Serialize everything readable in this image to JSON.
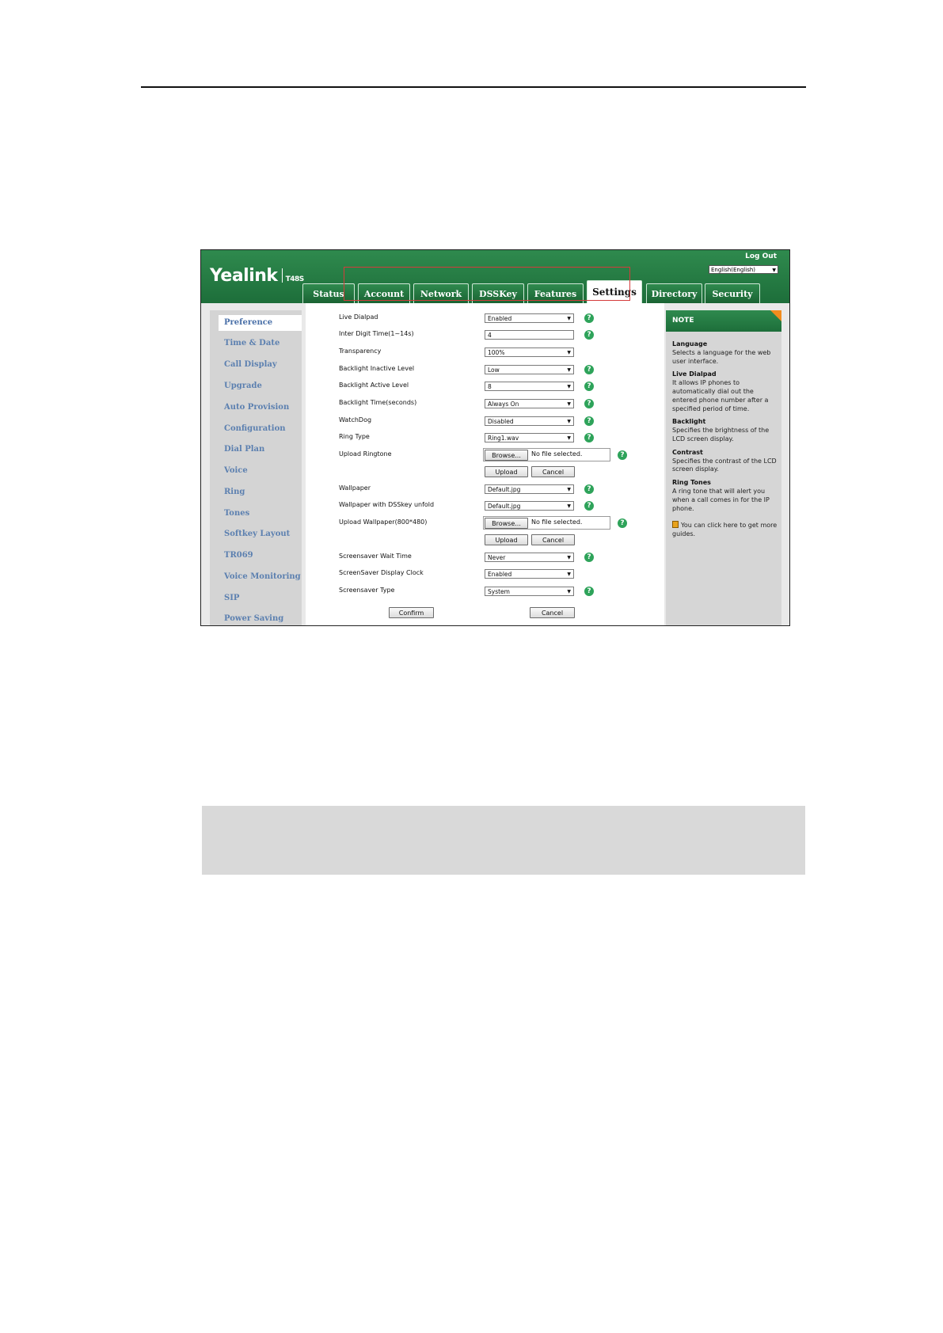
{
  "header": {
    "logo": "Yealink",
    "model": "T48S",
    "logout": "Log Out",
    "language": "English(English)"
  },
  "tabs": [
    "Status",
    "Account",
    "Network",
    "DSSKey",
    "Features",
    "Settings",
    "Directory",
    "Security"
  ],
  "active_tab": "Settings",
  "sidebar": {
    "items": [
      "Preference",
      "Time & Date",
      "Call Display",
      "Upgrade",
      "Auto Provision",
      "Configuration",
      "Dial Plan",
      "Voice",
      "Ring",
      "Tones",
      "Softkey Layout",
      "TR069",
      "Voice Monitoring",
      "SIP",
      "Power Saving"
    ],
    "active": "Preference"
  },
  "form": {
    "live_dialpad": {
      "label": "Live Dialpad",
      "value": "Enabled"
    },
    "inter_digit": {
      "label": "Inter Digit Time(1~14s)",
      "value": "4"
    },
    "transparency": {
      "label": "Transparency",
      "value": "100%"
    },
    "backlight_inactive": {
      "label": "Backlight Inactive Level",
      "value": "Low"
    },
    "backlight_active": {
      "label": "Backlight Active Level",
      "value": "8"
    },
    "backlight_time": {
      "label": "Backlight Time(seconds)",
      "value": "Always On"
    },
    "watchdog": {
      "label": "WatchDog",
      "value": "Disabled"
    },
    "ring_type": {
      "label": "Ring Type",
      "value": "Ring1.wav"
    },
    "upload_ringtone": {
      "label": "Upload Ringtone"
    },
    "wallpaper": {
      "label": "Wallpaper",
      "value": "Default.jpg"
    },
    "wallpaper_dsskey": {
      "label": "Wallpaper with DSSkey unfold",
      "value": "Default.jpg"
    },
    "upload_wallpaper": {
      "label": "Upload Wallpaper(800*480)"
    },
    "screensaver_wait": {
      "label": "Screensaver Wait Time",
      "value": "Never"
    },
    "screensaver_clock": {
      "label": "ScreenSaver Display Clock",
      "value": "Enabled"
    },
    "screensaver_type": {
      "label": "Screensaver Type",
      "value": "System"
    },
    "browse_label": "Browse...",
    "no_file": "No file selected.",
    "upload_label": "Upload",
    "cancel_label": "Cancel",
    "confirm_label": "Confirm"
  },
  "note": {
    "title": "NOTE",
    "language_title": "Language",
    "language_text": "Selects a language for the web user interface.",
    "live_dialpad_title": "Live Dialpad",
    "live_dialpad_text": "It allows IP phones to automatically dial out the entered phone number after a specified period of time.",
    "backlight_title": "Backlight",
    "backlight_text": "Specifies the brightness of the LCD screen display.",
    "contrast_title": "Contrast",
    "contrast_text": "Specifies the contrast of the LCD screen display.",
    "ringtones_title": "Ring Tones",
    "ringtones_text": "A ring tone that will alert you when a call comes in for the IP phone.",
    "guide_text": "You can click here to get more guides."
  },
  "colors": {
    "header_green": "#1d6e3a",
    "highlight_red": "#d43b3b",
    "note_orange": "#f28c1e",
    "help_green": "#2ea35a"
  }
}
